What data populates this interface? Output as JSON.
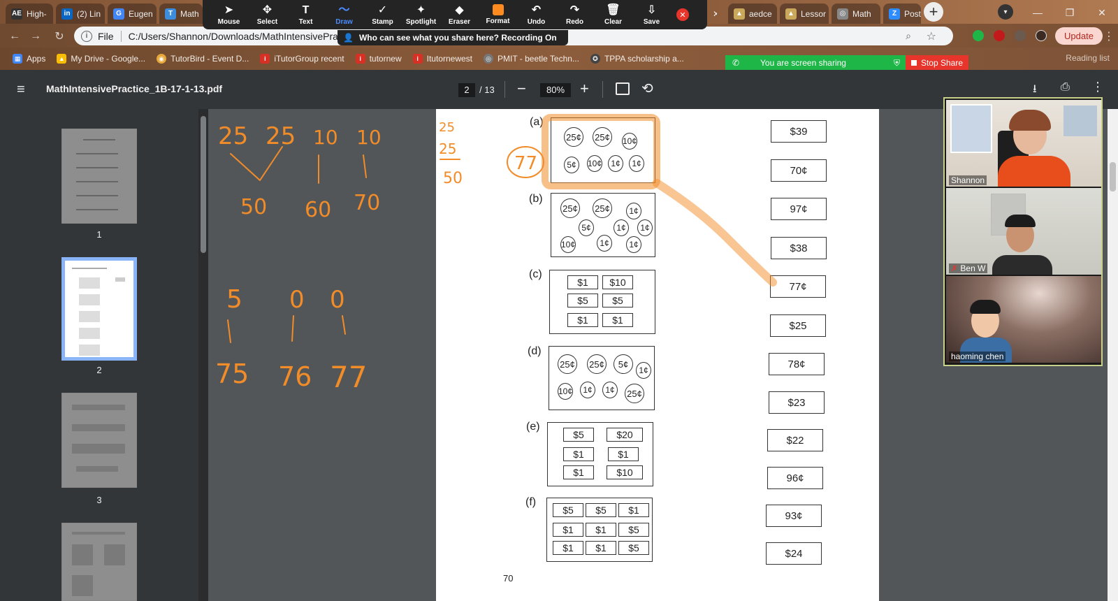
{
  "browser": {
    "tabs": [
      {
        "label": "High-",
        "icon": "AE",
        "color": "#333333"
      },
      {
        "label": "(2) Lin",
        "icon": "in",
        "color": "#0a66c2"
      },
      {
        "label": "Eugen",
        "icon": "G",
        "color": "#4285f4"
      },
      {
        "label": "Math",
        "icon": "T",
        "color": "#3c8dde"
      },
      {
        "label": "aedce",
        "icon": "▲",
        "color": "#c9a85c"
      },
      {
        "label": "Lessor",
        "icon": "▲",
        "color": "#c9a85c"
      },
      {
        "label": "Math",
        "icon": "◎",
        "color": "#888888"
      },
      {
        "label": "Post A",
        "icon": "Z",
        "color": "#2d8cff"
      }
    ],
    "url_scheme": "File",
    "url": "C:/Users/Shannon/Downloads/MathIntensivePrac",
    "update_label": "Update",
    "reading_list": "Reading list"
  },
  "zoom_toolbar": {
    "tools": [
      {
        "label": "Mouse",
        "icon": "➤"
      },
      {
        "label": "Select",
        "icon": "✥"
      },
      {
        "label": "Text",
        "icon": "T"
      },
      {
        "label": "Draw",
        "icon": "〜"
      },
      {
        "label": "Stamp",
        "icon": "✓"
      },
      {
        "label": "Spotlight",
        "icon": "✦"
      },
      {
        "label": "Eraser",
        "icon": "◆"
      },
      {
        "label": "Format",
        "icon": ""
      },
      {
        "label": "Undo",
        "icon": "↶"
      },
      {
        "label": "Redo",
        "icon": "↷"
      },
      {
        "label": "Clear",
        "icon": "🗑"
      },
      {
        "label": "Save",
        "icon": "⇩"
      }
    ],
    "active_tool": "Draw",
    "format_color": "#ff8a1f",
    "share_banner": "Who can see what you share here? Recording On",
    "screen_sharing": "You are screen sharing",
    "stop_share": "Stop Share"
  },
  "bookmarks": [
    {
      "label": "Apps",
      "color": "#4285f4"
    },
    {
      "label": "My Drive - Google...",
      "color": "#fbbc04"
    },
    {
      "label": "TutorBird - Event D...",
      "color": "#e8a83a"
    },
    {
      "label": "iTutorGroup recent",
      "color": "#d93025"
    },
    {
      "label": "tutornew",
      "color": "#d93025"
    },
    {
      "label": "Itutornewest",
      "color": "#d93025"
    },
    {
      "label": "PMIT - beetle Techn...",
      "color": "#777777"
    },
    {
      "label": "TPPA scholarship a...",
      "color": "#444444"
    }
  ],
  "pdf_viewer": {
    "filename": "MathIntensivePractice_1B-17-1-13.pdf",
    "current_page": "2",
    "total_pages": "/ 13",
    "zoom": "80%",
    "thumbnails": [
      "1",
      "2",
      "3"
    ],
    "page_number_footer": "70"
  },
  "worksheet": {
    "items": [
      {
        "label": "(a)",
        "coins": [
          "25¢",
          "25¢",
          "10¢",
          "5¢",
          "10¢",
          "1¢",
          "1¢"
        ]
      },
      {
        "label": "(b)",
        "coins": [
          "25¢",
          "25¢",
          "1¢",
          "5¢",
          "1¢",
          "1¢",
          "10¢",
          "1¢",
          "1¢"
        ]
      },
      {
        "label": "(c)",
        "notes": [
          "$1",
          "$10",
          "$5",
          "$5",
          "$1",
          "$1"
        ]
      },
      {
        "label": "(d)",
        "coins": [
          "25¢",
          "25¢",
          "5¢",
          "1¢",
          "10¢",
          "1¢",
          "1¢",
          "25¢"
        ]
      },
      {
        "label": "(e)",
        "notes": [
          "$5",
          "$20",
          "$1",
          "$1",
          "$1",
          "$10"
        ]
      },
      {
        "label": "(f)",
        "notes": [
          "$5",
          "$5",
          "$1",
          "$1",
          "$1",
          "$5",
          "$1",
          "$1",
          "$5"
        ]
      }
    ],
    "answers": [
      "$39",
      "70¢",
      "97¢",
      "$38",
      "77¢",
      "$25",
      "78¢",
      "$23",
      "$22",
      "96¢",
      "93¢",
      "$24"
    ]
  },
  "annotations": {
    "row1": [
      "25",
      "25",
      "10",
      "10"
    ],
    "row1_result": [
      "50",
      "60",
      "70"
    ],
    "row2": [
      "5",
      "0",
      "0"
    ],
    "row2_result": [
      "75",
      "76",
      "77"
    ],
    "side_sum": [
      "25",
      "25",
      "50"
    ],
    "circled": "77",
    "ink_color": "#f28c28"
  },
  "participants": [
    {
      "name": "Shannon"
    },
    {
      "name": "Ben W"
    },
    {
      "name": "haoming   chen"
    }
  ]
}
